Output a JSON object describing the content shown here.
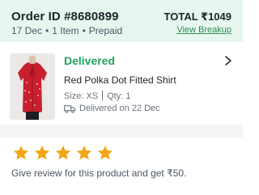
{
  "order": {
    "id_label": "Order ID #8680899",
    "date": "17 Dec",
    "items": "1 Item",
    "payment": "Prepaid",
    "separator": "•",
    "total": "TOTAL ₹1049",
    "view_breakup": "View Breakup"
  },
  "item": {
    "status": "Delivered",
    "name": "Red Polka Dot Fitted Shirt",
    "size": "Size: XS",
    "qty": "Qty: 1",
    "delivered_on": "Delivered on 22 Dec",
    "image": "red-polka-dot-shirt-photo",
    "chevron_icon": "chevron-right-icon",
    "truck_icon": "delivery-truck-icon"
  },
  "review": {
    "star_count": 5,
    "star_color": "#f2a516",
    "text": "Give review for this product and get ₹50."
  },
  "colors": {
    "header_bg": "#e7f7ef",
    "accent_green": "#22a45d",
    "link_green": "#2e8b57",
    "divider_bg": "#f3f4f6"
  }
}
